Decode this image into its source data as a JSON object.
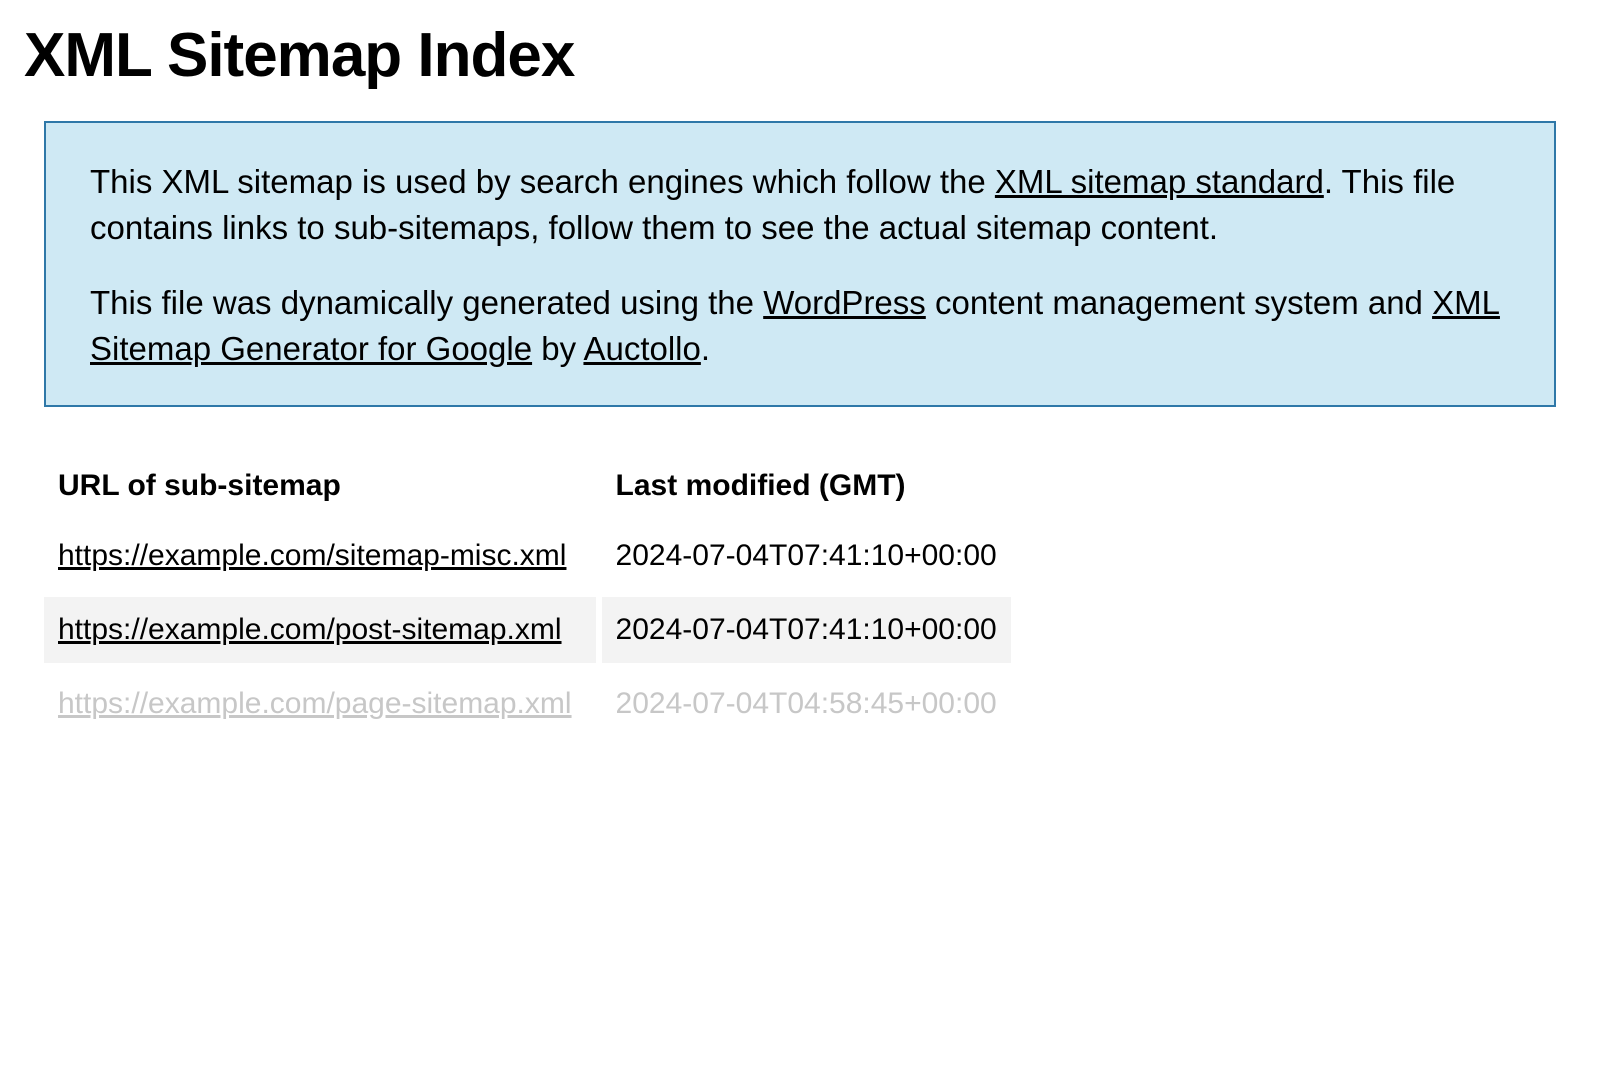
{
  "title": "XML Sitemap Index",
  "notice": {
    "p1_pre": "This XML sitemap is used by search engines which follow the ",
    "p1_link": "XML sitemap standard",
    "p1_post": ". This file contains links to sub-sitemaps, follow them to see the actual sitemap content.",
    "p2_pre": "This file was dynamically generated using the ",
    "p2_link1": "WordPress",
    "p2_mid": " content management system and ",
    "p2_link2": "XML Sitemap Generator for Google",
    "p2_by": " by ",
    "p2_link3": "Auctollo",
    "p2_end": "."
  },
  "table": {
    "header_url": "URL of sub-sitemap",
    "header_modified": "Last modified (GMT)",
    "rows": [
      {
        "url": "https://example.com/sitemap-misc.xml",
        "modified": "2024-07-04T07:41:10+00:00"
      },
      {
        "url": "https://example.com/post-sitemap.xml",
        "modified": "2024-07-04T07:41:10+00:00"
      },
      {
        "url": "https://example.com/page-sitemap.xml",
        "modified": "2024-07-04T04:58:45+00:00"
      }
    ]
  }
}
